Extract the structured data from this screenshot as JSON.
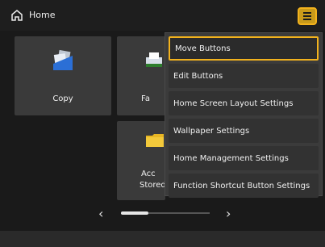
{
  "topbar": {
    "title": "Home"
  },
  "tiles": [
    {
      "label": "Copy"
    },
    {
      "label": "Fa"
    },
    {
      "label": "Acc"
    },
    {
      "label": "Stored"
    }
  ],
  "menu": {
    "items": [
      {
        "label": "Move Buttons"
      },
      {
        "label": "Edit Buttons"
      },
      {
        "label": "Home Screen Layout Settings"
      },
      {
        "label": "Wallpaper Settings"
      },
      {
        "label": "Home Management Settings"
      },
      {
        "label": "Function Shortcut Button Settings"
      }
    ]
  },
  "pager": {
    "prev": "‹",
    "next": "›"
  },
  "colors": {
    "accent": "#f2b21d",
    "background": "#1a1a1a",
    "tile": "#3a3a3a"
  }
}
